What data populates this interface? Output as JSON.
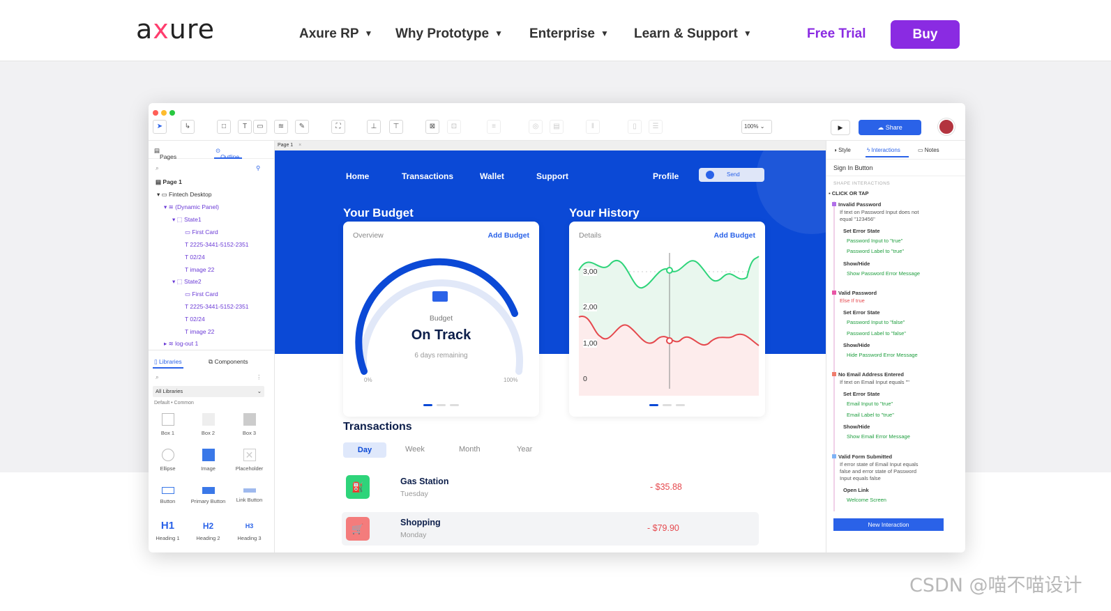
{
  "site": {
    "logo": "axure",
    "menu": [
      "Axure RP",
      "Why Prototype",
      "Enterprise",
      "Learn & Support"
    ],
    "free_trial": "Free Trial",
    "buy": "Buy",
    "accent": "#8a2be2"
  },
  "toolbar": {
    "zoom": "100%",
    "share": "Share"
  },
  "left": {
    "tab_pages": "Pages",
    "tab_outline": "Outline",
    "outline": [
      "Page 1",
      "Fintech Desktop",
      "(Dynamic Panel)",
      "State1",
      "First Card",
      "2225-3441-5152-2351",
      "02/24",
      "image 22",
      "State2",
      "First Card",
      "2225-3441-5152-2351",
      "02/24",
      "image 22",
      "log-out 1"
    ],
    "tab_libraries": "Libraries",
    "tab_components": "Components",
    "lib_select": "All Libraries",
    "lib_group": "Default • Common",
    "tiles": [
      "Box 1",
      "Box 2",
      "Box 3",
      "Ellipse",
      "Image",
      "Placeholder",
      "Button",
      "Primary Button",
      "Link Button",
      "Heading 1",
      "Heading 2",
      "Heading 3"
    ],
    "heading_glyphs": [
      "H1",
      "H2",
      "H3"
    ]
  },
  "canvas": {
    "page_tab": "Page 1",
    "nav": [
      "Home",
      "Transactions",
      "Wallet",
      "Support"
    ],
    "profile": "Profile",
    "send": "Send",
    "budget_title": "Your Budget",
    "history_title": "Your History",
    "budget_card": {
      "label": "Overview",
      "action": "Add Budget",
      "caption": "Budget",
      "status": "On Track",
      "sub": "6 days remaining",
      "min": "0%",
      "max": "100%"
    },
    "history_card": {
      "label": "Details",
      "action": "Add Budget",
      "ticks": [
        "3,00",
        "2,00",
        "1,00",
        "0"
      ]
    },
    "transactions_title": "Transactions",
    "periods": [
      "Day",
      "Week",
      "Month",
      "Year"
    ],
    "rows": [
      {
        "name": "Gas Station",
        "day": "Tuesday",
        "amount": "- $35.88"
      },
      {
        "name": "Shopping",
        "day": "Monday",
        "amount": "- $79.90"
      }
    ]
  },
  "right": {
    "tabs": [
      "Style",
      "Interactions",
      "Notes"
    ],
    "selected": "Sign In Button",
    "section": "SHAPE INTERACTIONS",
    "event": "CLICK OR TAP",
    "lines": [
      "Invalid Password",
      "If text on Password Input does not",
      "equal \"123456\"",
      "Set Error State",
      "Password Input to \"true\"",
      "Password Label to \"true\"",
      "Show/Hide",
      "Show Password Error Message",
      "Valid Password",
      "Else If true",
      "Set Error State",
      "Password Input to \"false\"",
      "Password Label to \"false\"",
      "Show/Hide",
      "Hide Password Error Message",
      "No Email Address Entered",
      "If text on Email Input equals \"\"",
      "Set Error State",
      "Email Input to \"true\"",
      "Email Label to \"true\"",
      "Show/Hide",
      "Show Email Error Message",
      "Valid Form Submitted",
      "If error state of Email Input equals",
      "false and error state of Password",
      "Input equals false",
      "Open Link",
      "Welcome Screen"
    ],
    "new_interaction": "New Interaction"
  },
  "watermark": "CSDN @喵不喵设计"
}
